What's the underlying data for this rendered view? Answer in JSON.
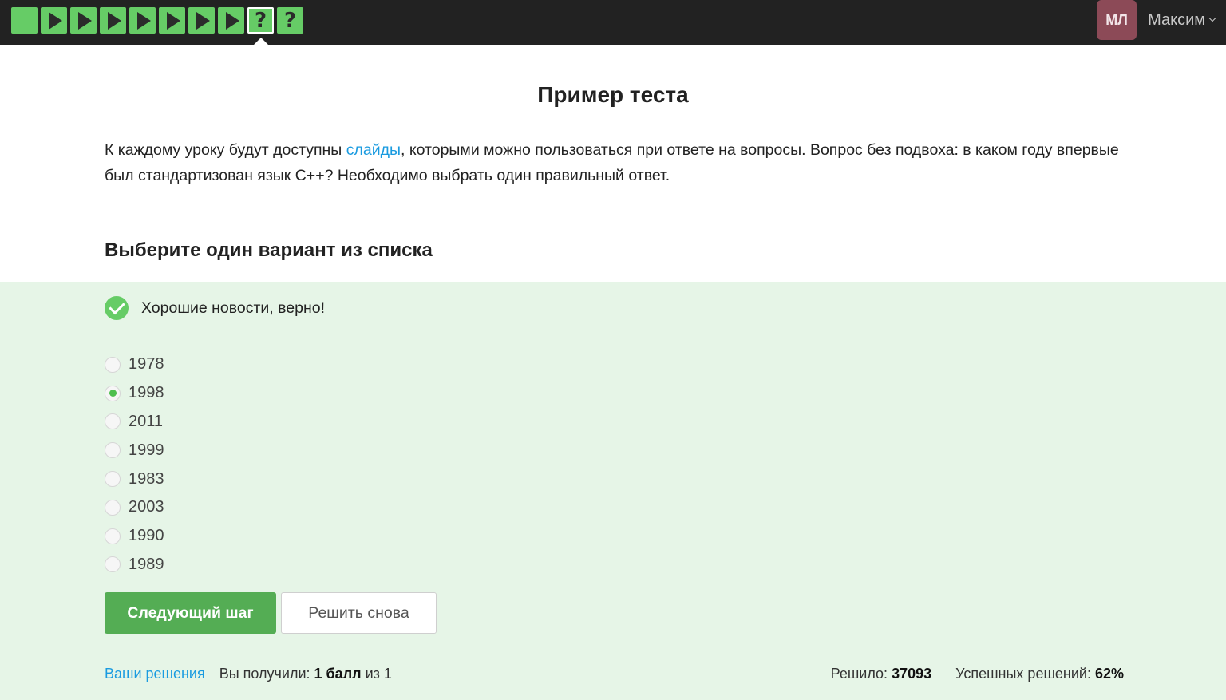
{
  "steps": [
    {
      "type": "text",
      "name": "step-1"
    },
    {
      "type": "video",
      "name": "step-2"
    },
    {
      "type": "video",
      "name": "step-3"
    },
    {
      "type": "video",
      "name": "step-4"
    },
    {
      "type": "video",
      "name": "step-5"
    },
    {
      "type": "video",
      "name": "step-6"
    },
    {
      "type": "video",
      "name": "step-7"
    },
    {
      "type": "video",
      "name": "step-8"
    },
    {
      "type": "quiz",
      "name": "step-9",
      "label": "?",
      "active": true
    },
    {
      "type": "quiz",
      "name": "step-10",
      "label": "?"
    }
  ],
  "user": {
    "initials": "МЛ",
    "name": "Максим"
  },
  "lesson": {
    "title": "Пример теста",
    "desc_before": "К каждому уроку будут доступны ",
    "desc_link": "слайды",
    "desc_after": ", которыми можно пользоваться при ответе на вопросы. Вопрос без подвоха: в каком году впервые был стандартизован язык C++? Необходимо выбрать один правильный ответ.",
    "subtitle": "Выберите один вариант из списка"
  },
  "result": {
    "verdict": "Хорошие новости, верно!"
  },
  "options": [
    {
      "label": "1978",
      "checked": false
    },
    {
      "label": "1998",
      "checked": true
    },
    {
      "label": "2011",
      "checked": false
    },
    {
      "label": "1999",
      "checked": false
    },
    {
      "label": "1983",
      "checked": false
    },
    {
      "label": "2003",
      "checked": false
    },
    {
      "label": "1990",
      "checked": false
    },
    {
      "label": "1989",
      "checked": false
    }
  ],
  "buttons": {
    "next": "Следующий шаг",
    "retry": "Решить снова"
  },
  "footer": {
    "solutions_link": "Ваши решения",
    "score_prefix": "Вы получили: ",
    "score_value": "1 балл",
    "score_suffix": " из 1",
    "solved_label": "Решило: ",
    "solved_value": "37093",
    "success_label": "Успешных решений: ",
    "success_value": "62%"
  },
  "colors": {
    "accent": "#66cc66",
    "button": "#54ad54",
    "link": "#1a9be0",
    "result_bg": "#e6f5e7",
    "avatar": "#8c4a57"
  }
}
